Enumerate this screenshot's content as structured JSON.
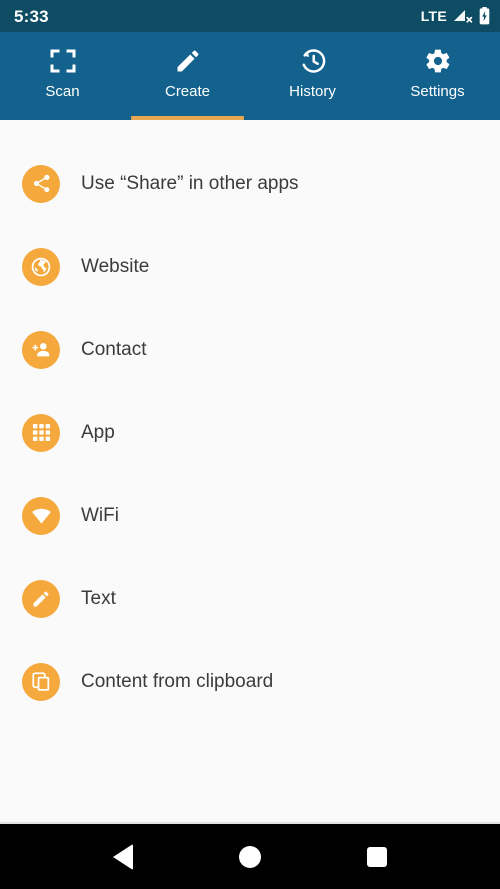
{
  "status_bar": {
    "time": "5:33",
    "network_label": "LTE",
    "signal_icon": "signal-no-service-icon",
    "battery_icon": "battery-charging-icon",
    "background_color": "#0E4C63"
  },
  "tabs": {
    "active_index": 1,
    "background_color": "#13628E",
    "indicator_color": "#E8A552",
    "items": [
      {
        "label": "Scan",
        "icon": "scan-viewfinder-icon",
        "active": false
      },
      {
        "label": "Create",
        "icon": "pencil-icon",
        "active": true
      },
      {
        "label": "History",
        "icon": "history-clock-icon",
        "active": false
      },
      {
        "label": "Settings",
        "icon": "gear-icon",
        "active": false
      }
    ]
  },
  "create_list": {
    "badge_color": "#F5A83C",
    "background_color": "#FAFAFA",
    "items": [
      {
        "label": "Use “Share” in other apps",
        "icon": "share-icon"
      },
      {
        "label": "Website",
        "icon": "globe-icon"
      },
      {
        "label": "Contact",
        "icon": "person-add-icon"
      },
      {
        "label": "App",
        "icon": "apps-grid-icon"
      },
      {
        "label": "WiFi",
        "icon": "wifi-icon"
      },
      {
        "label": "Text",
        "icon": "pencil-icon"
      },
      {
        "label": "Content from clipboard",
        "icon": "copy-icon"
      }
    ]
  },
  "nav_bar": {
    "background_color": "#000000",
    "buttons": [
      {
        "name": "back",
        "icon": "triangle-back-icon"
      },
      {
        "name": "home",
        "icon": "circle-home-icon"
      },
      {
        "name": "recents",
        "icon": "square-recents-icon"
      }
    ]
  }
}
